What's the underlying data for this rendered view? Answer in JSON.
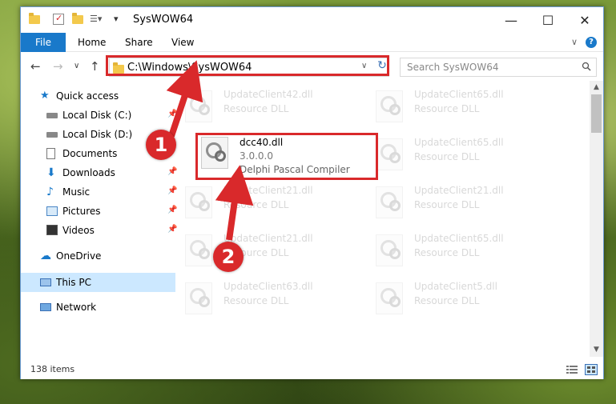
{
  "window": {
    "title": "SysWOW64",
    "minimize": "—",
    "maximize": "☐",
    "close": "✕"
  },
  "ribbon": {
    "tabs": [
      "File",
      "Home",
      "Share",
      "View"
    ],
    "expand": "∨",
    "help": "?"
  },
  "navbar": {
    "back": "←",
    "forward": "→",
    "recent": "∨",
    "up": "↑",
    "address": "C:\\Windows\\SysWOW64",
    "address_dropdown": "∨",
    "refresh": "↻",
    "search_placeholder": "Search SysWOW64"
  },
  "sidebar": {
    "items": [
      {
        "label": "Quick access",
        "icon": "star-icon"
      },
      {
        "label": "Local Disk (C:)",
        "icon": "drive-icon"
      },
      {
        "label": "Local Disk (D:)",
        "icon": "drive-icon"
      },
      {
        "label": "Documents",
        "icon": "documents-icon"
      },
      {
        "label": "Downloads",
        "icon": "downloads-icon"
      },
      {
        "label": "Music",
        "icon": "music-icon"
      },
      {
        "label": "Pictures",
        "icon": "pictures-icon"
      },
      {
        "label": "Videos",
        "icon": "videos-icon"
      },
      {
        "label": "OneDrive",
        "icon": "onedrive-icon"
      },
      {
        "label": "This PC",
        "icon": "computer-icon"
      },
      {
        "label": "Network",
        "icon": "network-icon"
      }
    ],
    "pin": "📌"
  },
  "files": [
    {
      "name": "UpdateClient42.dll",
      "type": "Resource DLL"
    },
    {
      "name": "UpdateClient65.dll",
      "type": "Resource DLL"
    },
    {
      "name": "UpdateClient65.dll",
      "type": "Resource DLL"
    },
    {
      "name": "UpdateClient21.dll",
      "type": "Resource DLL"
    },
    {
      "name": "UpdateClient21.dll",
      "type": "Resource DLL"
    },
    {
      "name": "UpdateClient21.dll",
      "type": "Resource DLL"
    },
    {
      "name": "UpdateClient65.dll",
      "type": "Resource DLL"
    },
    {
      "name": "UpdateClient63.dll",
      "type": "Resource DLL"
    },
    {
      "name": "UpdateClient5.dll",
      "type": "Resource DLL"
    }
  ],
  "highlighted_file": {
    "name": "dcc40.dll",
    "version": "3.0.0.0",
    "description": "Delphi Pascal Compiler"
  },
  "status": {
    "item_count": "138 items"
  },
  "annotations": {
    "step1": "1",
    "step2": "2",
    "color": "#d9292b"
  },
  "colors": {
    "accent": "#1979ca",
    "selection": "#cce8ff"
  }
}
